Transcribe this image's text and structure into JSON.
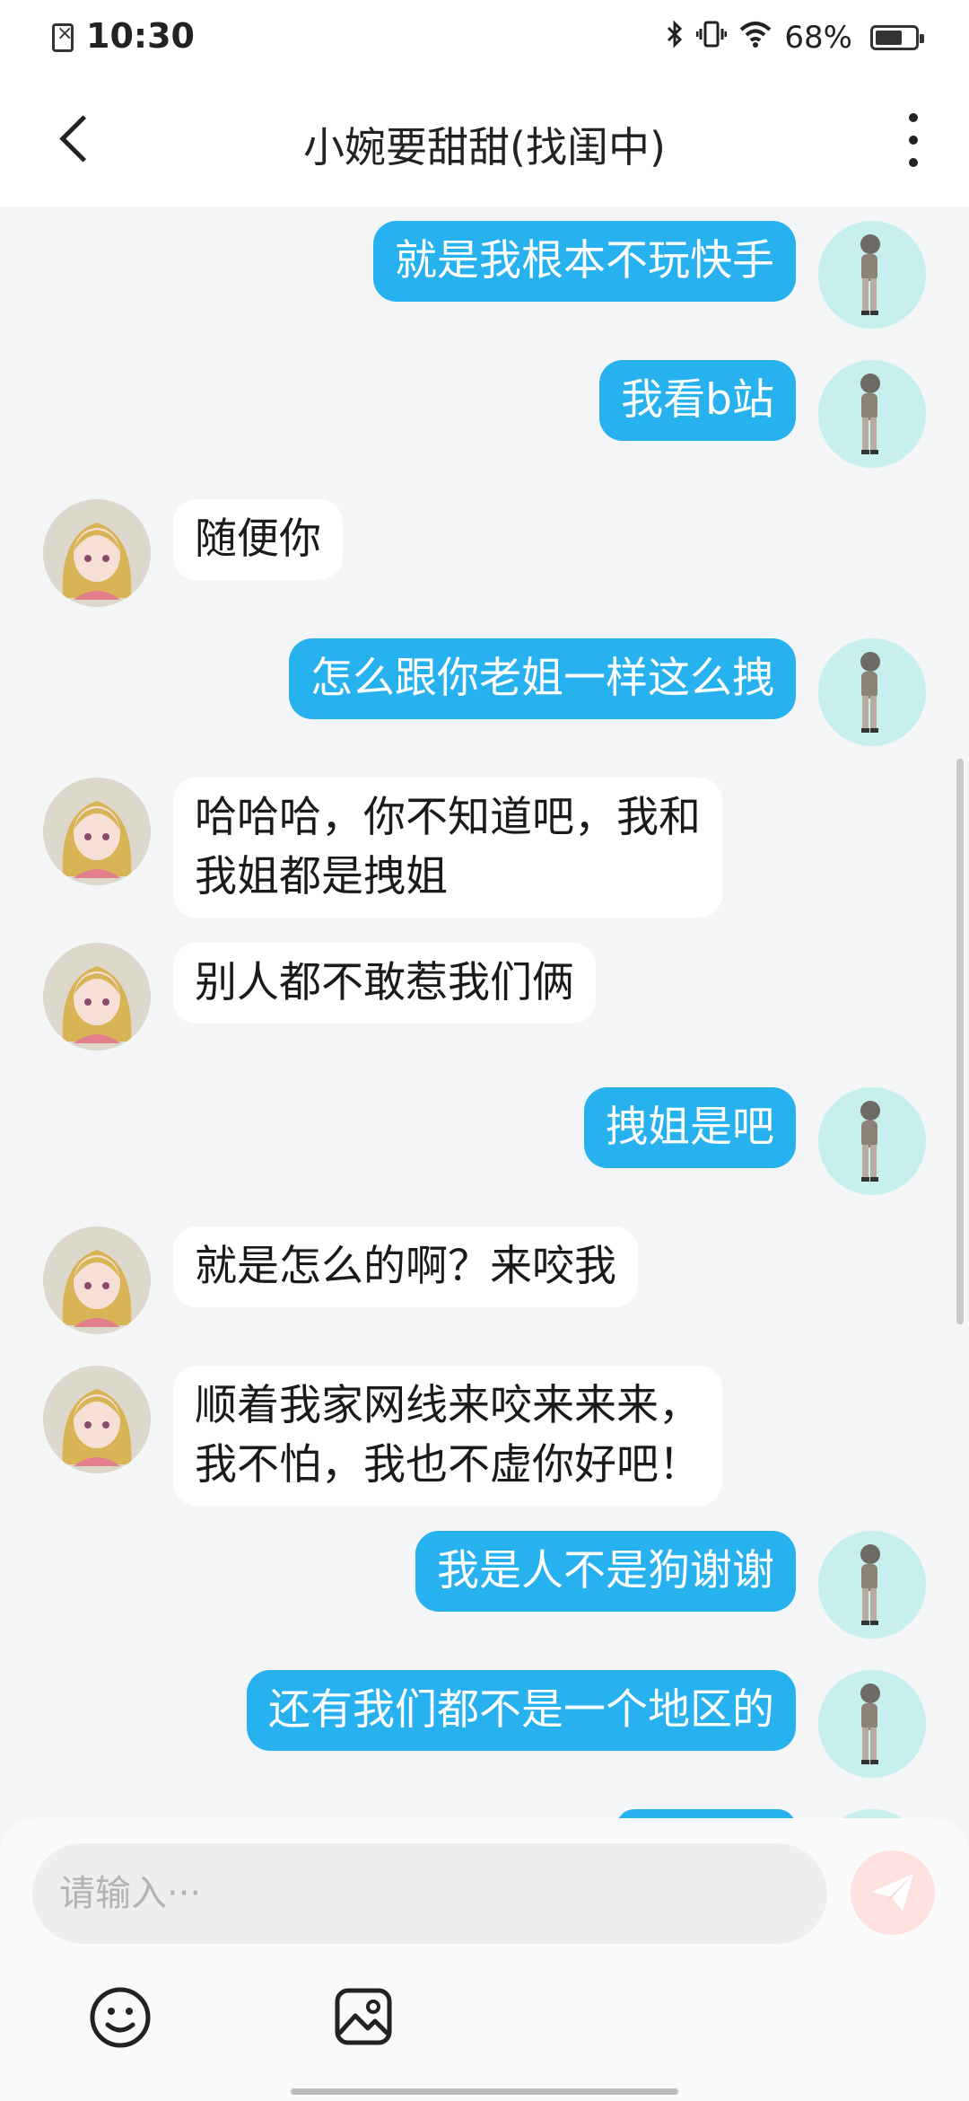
{
  "status_bar": {
    "time": "10:30",
    "battery": "68%",
    "battery_level": 0.68
  },
  "header": {
    "title": "小婉要甜甜(找闺中)"
  },
  "messages": [
    {
      "sender": "me",
      "text": "就是我根本不玩快手"
    },
    {
      "sender": "me",
      "text": "我看b站"
    },
    {
      "sender": "them",
      "text": "随便你"
    },
    {
      "sender": "me",
      "text": "怎么跟你老姐一样这么拽"
    },
    {
      "sender": "them",
      "lines": [
        "哈哈哈，你不知道吧，我和",
        "我姐都是拽姐"
      ]
    },
    {
      "sender": "them",
      "text": "别人都不敢惹我们俩"
    },
    {
      "sender": "me",
      "text": "拽姐是吧"
    },
    {
      "sender": "them",
      "text": "就是怎么的啊？来咬我"
    },
    {
      "sender": "them",
      "lines": [
        "顺着我家网线来咬来来来，",
        "我不怕，我也不虚你好吧！"
      ]
    },
    {
      "sender": "me",
      "text": "我是人不是狗谢谢"
    },
    {
      "sender": "me",
      "text": "还有我们都不是一个地区的"
    }
  ],
  "composer": {
    "placeholder": "请输入···"
  },
  "icons": {
    "back": "chevron-left-icon",
    "more": "more-vertical-icon",
    "send": "send-icon",
    "emoji": "smiley-icon",
    "image": "image-icon"
  },
  "colors": {
    "outgoing_bubble": "#27b2ef",
    "incoming_bubble": "#ffffff",
    "send_button": "#fde2e0"
  }
}
